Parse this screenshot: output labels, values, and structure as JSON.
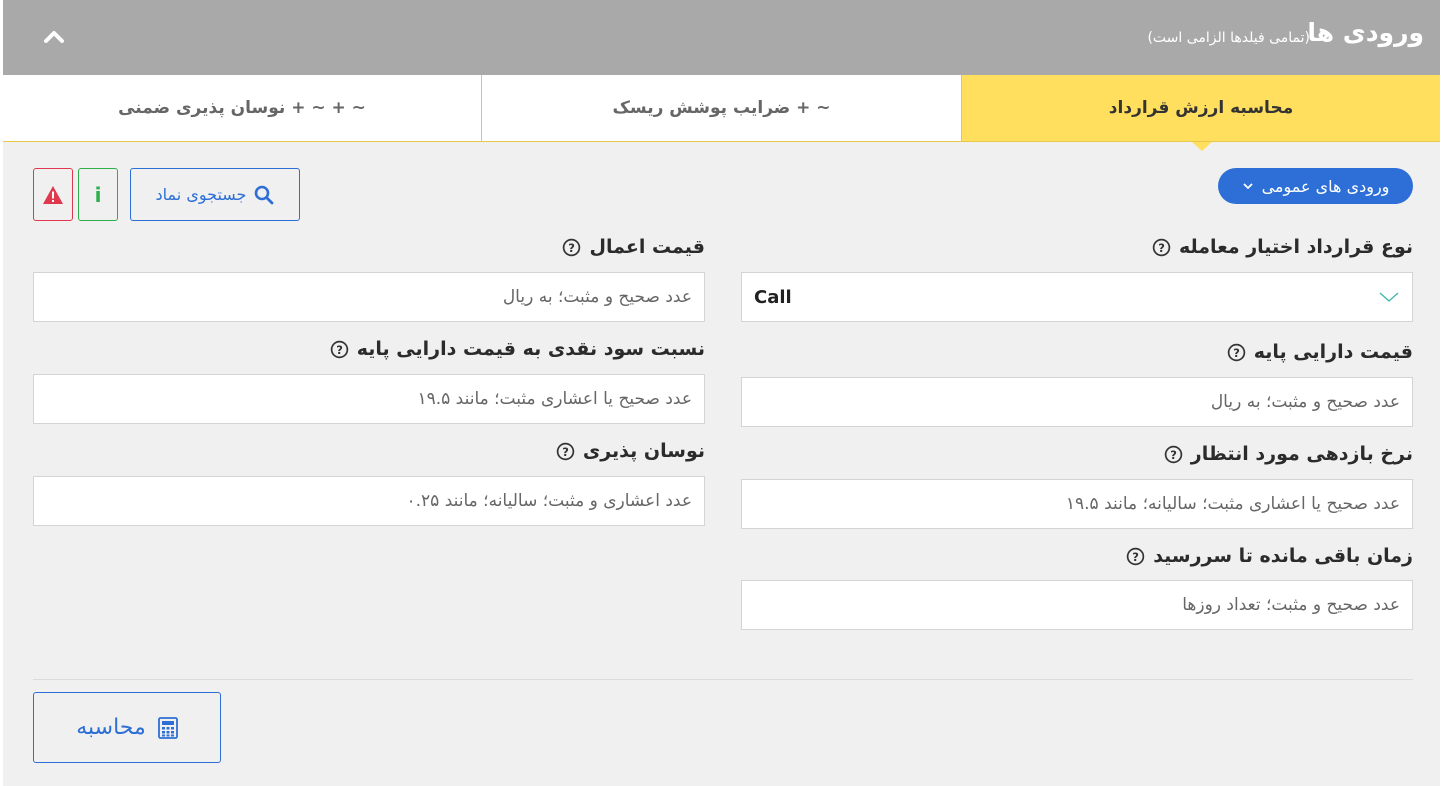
{
  "header": {
    "title": "ورودی ها",
    "note": "(تمامی فیلدها الزامی است)"
  },
  "tabs": [
    {
      "label": "محاسبه ارزش قرارداد",
      "active": true
    },
    {
      "label": "~ + ضرایب پوشش ریسک",
      "active": false
    },
    {
      "label": "~ + ~ + نوسان پذیری ضمنی",
      "active": false
    }
  ],
  "toolbar": {
    "general_inputs": "ورودی های عمومی",
    "search_symbol": "جستجوی نماد"
  },
  "fields": {
    "option_type": {
      "label": "نوع قرارداد اختیار معامله",
      "value": "Call"
    },
    "underlying_price": {
      "label": "قیمت دارایی پایه",
      "placeholder": "عدد صحیح و مثبت؛ به ریال"
    },
    "expected_return": {
      "label": "نرخ بازدهی مورد انتظار",
      "placeholder": "عدد صحیح یا اعشاری مثبت؛ سالیانه؛ مانند ۱۹.۵"
    },
    "time_to_maturity": {
      "label": "زمان باقی مانده تا سررسید",
      "placeholder": "عدد صحیح و مثبت؛ تعداد روزها"
    },
    "strike_price": {
      "label": "قیمت اعمال",
      "placeholder": "عدد صحیح و مثبت؛ به ریال"
    },
    "dividend_ratio": {
      "label": "نسبت سود نقدی به قیمت دارایی پایه",
      "placeholder": "عدد صحیح یا اعشاری مثبت؛ مانند ۱۹.۵"
    },
    "volatility": {
      "label": "نوسان پذیری",
      "placeholder": "عدد اعشاری و مثبت؛ سالیانه؛ مانند ۰.۲۵"
    }
  },
  "actions": {
    "calculate": "محاسبه"
  },
  "colors": {
    "header_bg": "#a9a9a9",
    "active_tab": "#ffdf5d",
    "accent_blue": "#2d6fd6",
    "info_green": "#2db04a",
    "warn_red": "#e0394f"
  }
}
